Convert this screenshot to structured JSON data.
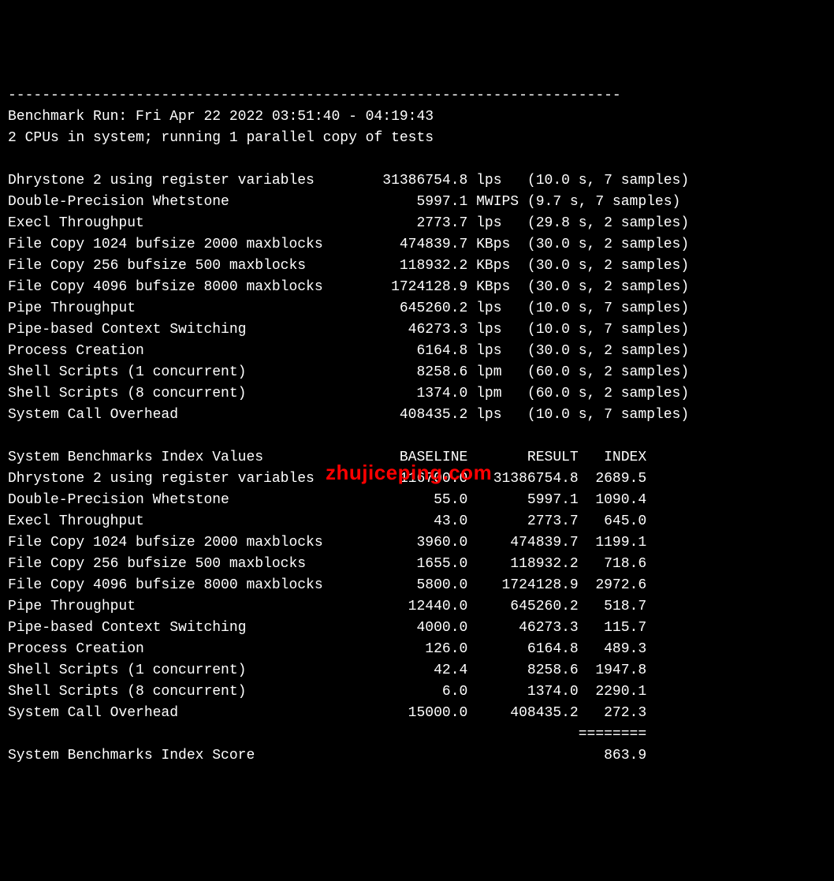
{
  "header": {
    "dashes": "------------------------------------------------------------------------",
    "run_line": "Benchmark Run: Fri Apr 22 2022 03:51:40 - 04:19:43",
    "cpu_line": "2 CPUs in system; running 1 parallel copy of tests"
  },
  "results": [
    {
      "name": "Dhrystone 2 using register variables",
      "value": "31386754.8",
      "unit": "lps",
      "timing": "(10.0 s, 7 samples)"
    },
    {
      "name": "Double-Precision Whetstone",
      "value": "5997.1",
      "unit": "MWIPS",
      "timing": "(9.7 s, 7 samples)"
    },
    {
      "name": "Execl Throughput",
      "value": "2773.7",
      "unit": "lps",
      "timing": "(29.8 s, 2 samples)"
    },
    {
      "name": "File Copy 1024 bufsize 2000 maxblocks",
      "value": "474839.7",
      "unit": "KBps",
      "timing": "(30.0 s, 2 samples)"
    },
    {
      "name": "File Copy 256 bufsize 500 maxblocks",
      "value": "118932.2",
      "unit": "KBps",
      "timing": "(30.0 s, 2 samples)"
    },
    {
      "name": "File Copy 4096 bufsize 8000 maxblocks",
      "value": "1724128.9",
      "unit": "KBps",
      "timing": "(30.0 s, 2 samples)"
    },
    {
      "name": "Pipe Throughput",
      "value": "645260.2",
      "unit": "lps",
      "timing": "(10.0 s, 7 samples)"
    },
    {
      "name": "Pipe-based Context Switching",
      "value": "46273.3",
      "unit": "lps",
      "timing": "(10.0 s, 7 samples)"
    },
    {
      "name": "Process Creation",
      "value": "6164.8",
      "unit": "lps",
      "timing": "(30.0 s, 2 samples)"
    },
    {
      "name": "Shell Scripts (1 concurrent)",
      "value": "8258.6",
      "unit": "lpm",
      "timing": "(60.0 s, 2 samples)"
    },
    {
      "name": "Shell Scripts (8 concurrent)",
      "value": "1374.0",
      "unit": "lpm",
      "timing": "(60.0 s, 2 samples)"
    },
    {
      "name": "System Call Overhead",
      "value": "408435.2",
      "unit": "lps",
      "timing": "(10.0 s, 7 samples)"
    }
  ],
  "index_header": {
    "title": "System Benchmarks Index Values",
    "baseline": "BASELINE",
    "result": "RESULT",
    "index": "INDEX"
  },
  "index_rows": [
    {
      "name": "Dhrystone 2 using register variables",
      "baseline": "116700.0",
      "result": "31386754.8",
      "index": "2689.5"
    },
    {
      "name": "Double-Precision Whetstone",
      "baseline": "55.0",
      "result": "5997.1",
      "index": "1090.4"
    },
    {
      "name": "Execl Throughput",
      "baseline": "43.0",
      "result": "2773.7",
      "index": "645.0"
    },
    {
      "name": "File Copy 1024 bufsize 2000 maxblocks",
      "baseline": "3960.0",
      "result": "474839.7",
      "index": "1199.1"
    },
    {
      "name": "File Copy 256 bufsize 500 maxblocks",
      "baseline": "1655.0",
      "result": "118932.2",
      "index": "718.6"
    },
    {
      "name": "File Copy 4096 bufsize 8000 maxblocks",
      "baseline": "5800.0",
      "result": "1724128.9",
      "index": "2972.6"
    },
    {
      "name": "Pipe Throughput",
      "baseline": "12440.0",
      "result": "645260.2",
      "index": "518.7"
    },
    {
      "name": "Pipe-based Context Switching",
      "baseline": "4000.0",
      "result": "46273.3",
      "index": "115.7"
    },
    {
      "name": "Process Creation",
      "baseline": "126.0",
      "result": "6164.8",
      "index": "489.3"
    },
    {
      "name": "Shell Scripts (1 concurrent)",
      "baseline": "42.4",
      "result": "8258.6",
      "index": "1947.8"
    },
    {
      "name": "Shell Scripts (8 concurrent)",
      "baseline": "6.0",
      "result": "1374.0",
      "index": "2290.1"
    },
    {
      "name": "System Call Overhead",
      "baseline": "15000.0",
      "result": "408435.2",
      "index": "272.3"
    }
  ],
  "score_separator": "                                                                   ========",
  "score_line": {
    "label": "System Benchmarks Index Score",
    "value": "863.9"
  },
  "watermark": "zhujiceping.com"
}
